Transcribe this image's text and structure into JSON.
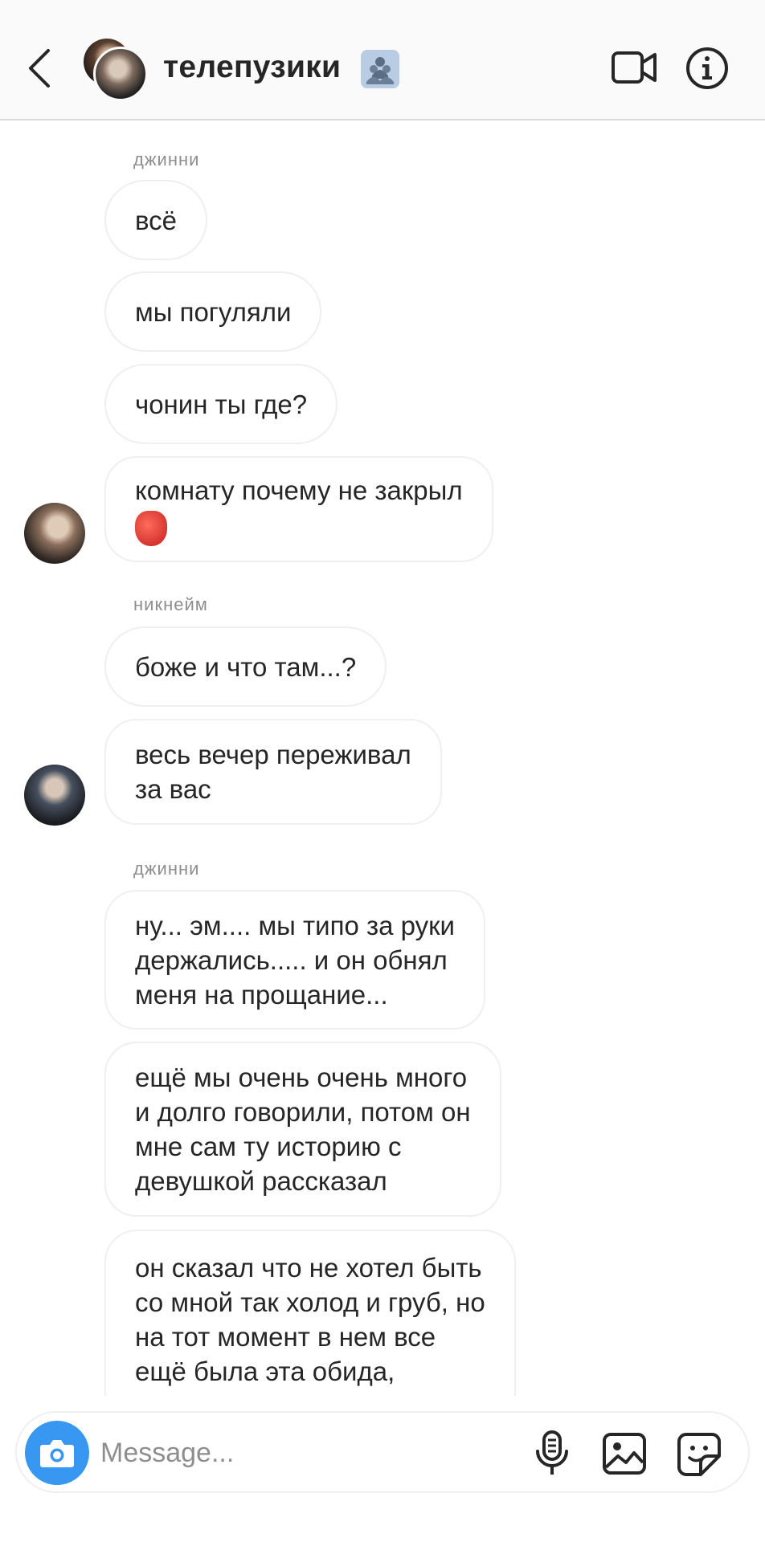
{
  "header": {
    "title": "телепузики",
    "group_emoji": "busts-in-silhouette-icon",
    "icons": [
      "back-chevron-icon",
      "video-camera-icon",
      "info-icon"
    ]
  },
  "thread": {
    "groups": [
      {
        "sender": "джинни",
        "messages": [
          "всё",
          "мы погуляли",
          "чонин ты где?",
          "комнату почему не закрыл"
        ],
        "last_message_emoji": "red-mask-emoji"
      },
      {
        "sender": "никнейм",
        "messages": [
          "боже и что там...?",
          "весь вечер переживал\nза вас"
        ]
      },
      {
        "sender": "джинни",
        "messages": [
          "ну... эм.... мы типо за руки\nдержались..... и он обнял\nменя на прощание...",
          "ещё мы очень очень много\nи долго говорили, потом он\nмне сам ту историю с\nдевушкой рассказал",
          "он сказал что не хотел быть\nсо мной так холод и груб, но\nна тот момент в нем все\nещё была эта обида,"
        ]
      }
    ]
  },
  "composer": {
    "placeholder": "Message...",
    "icons": [
      "camera-icon",
      "microphone-icon",
      "gallery-icon",
      "sticker-icon"
    ]
  },
  "colors": {
    "accent": "#3897f0",
    "bubble_border": "#efefef",
    "text": "#262626",
    "secondary_text": "#8e8e8e",
    "header_bg": "#fafafa"
  }
}
